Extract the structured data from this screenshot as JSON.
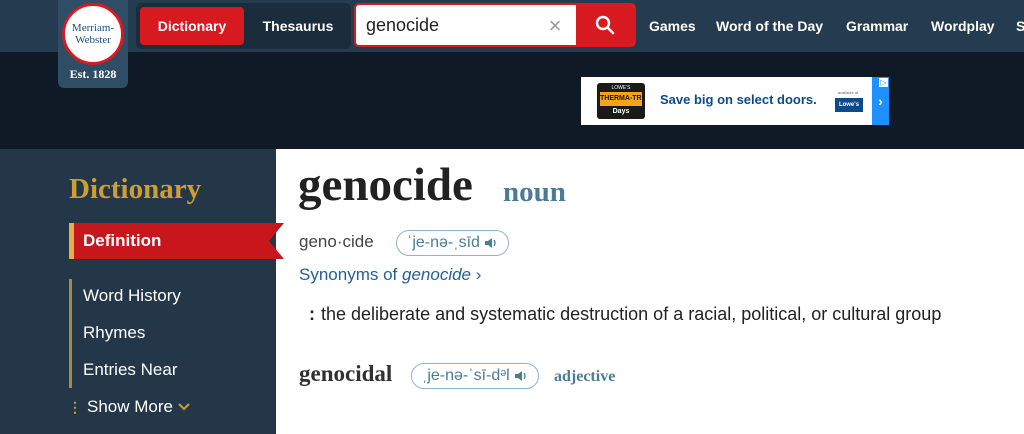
{
  "logo": {
    "line1": "Merriam-",
    "line2": "Webster",
    "est": "Est. 1828"
  },
  "tabs": {
    "dictionary": "Dictionary",
    "thesaurus": "Thesaurus"
  },
  "search": {
    "value": "genocide",
    "clear_icon": "close-icon",
    "submit_icon": "search-icon"
  },
  "nav": {
    "items": [
      "Games",
      "Word of the Day",
      "Grammar",
      "Wordplay",
      "S"
    ]
  },
  "ad": {
    "badge_top": "LOWE'S",
    "badge_mid": "THERMA-TRU",
    "badge_bottom": "Days",
    "text": "Save big on select doors.",
    "available": "available at",
    "brand": "Lowe's"
  },
  "sidebar": {
    "title": "Dictionary",
    "active": "Definition",
    "items": [
      "Word History",
      "Rhymes",
      "Entries Near"
    ],
    "more": "Show More"
  },
  "entry": {
    "headword": "genocide",
    "part_of_speech": "noun",
    "syllables": "geno·cide",
    "pronunciation": "ˈje-nə-ˌsīd",
    "synonyms_prefix": "Synonyms of ",
    "synonyms_word": "genocide",
    "synonyms_suffix": " ›",
    "def_colon": ":",
    "definition": "the deliberate and systematic destruction of a racial, political, or cultural group",
    "run_on": {
      "word": "genocidal",
      "pronunciation": "ˌje-nə-ˈsī-dᵊl",
      "part_of_speech": "adjective"
    }
  },
  "colors": {
    "header": "#253b50",
    "accent_red": "#d71920",
    "sidebar": "#233749",
    "gold": "#cc9e36",
    "link": "#265e97",
    "pos": "#4a7d95"
  }
}
